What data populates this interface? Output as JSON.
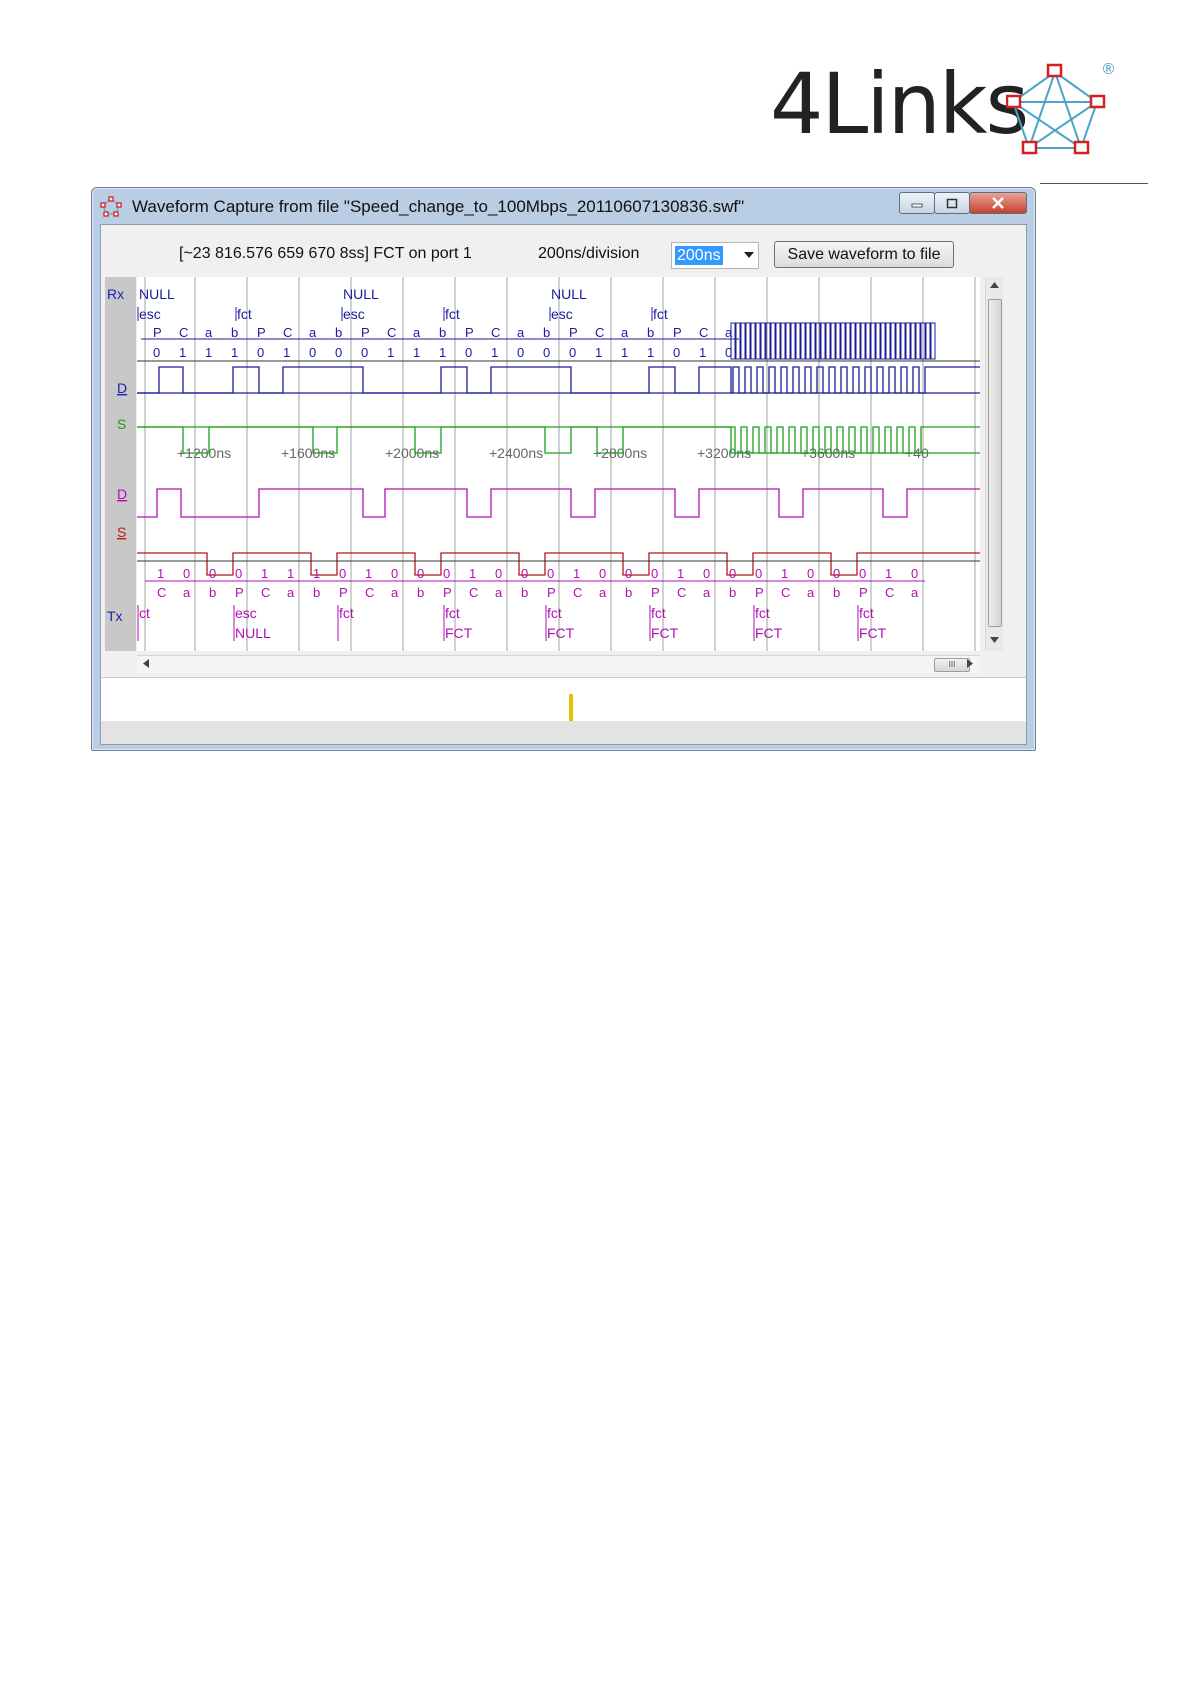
{
  "logo": {
    "text": "4Links",
    "registered": "®"
  },
  "window": {
    "title": "Waveform Capture from file \"Speed_change_to_100Mbps_20110607130836.swf\"",
    "buttons": {
      "minimize": "minimize",
      "maximize": "maximize",
      "close": "close"
    }
  },
  "toolbar": {
    "status": "[~23 816.576 659 670 8ss] FCT on port 1",
    "division": "200ns/division",
    "zoom": "200ns",
    "save_label": "Save waveform to file"
  },
  "labels": {
    "rx": "Rx",
    "tx": "Tx",
    "d": "D",
    "s": "S"
  },
  "colors": {
    "rx_d": "#1c1c9c",
    "rx_s": "#1aa01a",
    "tx_d": "#b010b0",
    "tx_s": "#b01818",
    "grid": "#8a8a8a",
    "selection": "#3399ff",
    "marker": "#e8c000"
  },
  "time_labels": [
    "+1200ns",
    "+1600ns",
    "+2000ns",
    "+2400ns",
    "+2800ns",
    "+3200ns",
    "+3600ns",
    "+40"
  ],
  "rx_tokens": [
    {
      "name": "NULL",
      "sub": "esc"
    },
    {
      "name": "",
      "sub": "fct"
    },
    {
      "name": "NULL",
      "sub": "esc"
    },
    {
      "name": "",
      "sub": "fct"
    },
    {
      "name": "NULL",
      "sub": "esc"
    },
    {
      "name": "",
      "sub": "fct"
    }
  ],
  "rx_fields": [
    "P",
    "C",
    "a",
    "b",
    "P",
    "C",
    "a",
    "b",
    "P",
    "C",
    "a",
    "b",
    "P",
    "C",
    "a",
    "b",
    "P",
    "C",
    "a",
    "b",
    "P",
    "C",
    "a"
  ],
  "rx_bits": [
    "0",
    "1",
    "1",
    "1",
    "0",
    "1",
    "0",
    "0",
    "0",
    "1",
    "1",
    "1",
    "0",
    "1",
    "0",
    "0",
    "0",
    "1",
    "1",
    "1",
    "0",
    "1",
    "0"
  ],
  "tx_bits": [
    "1",
    "0",
    "0",
    "0",
    "1",
    "1",
    "1",
    "0",
    "1",
    "0",
    "0",
    "0",
    "1",
    "0",
    "0",
    "0",
    "1",
    "0",
    "0",
    "0",
    "1",
    "0",
    "0",
    "0",
    "1",
    "0",
    "0",
    "0",
    "1",
    "0"
  ],
  "tx_fields": [
    "C",
    "a",
    "b",
    "P",
    "C",
    "a",
    "b",
    "P",
    "C",
    "a",
    "b",
    "P",
    "C",
    "a",
    "b",
    "P",
    "C",
    "a",
    "b",
    "P",
    "C",
    "a",
    "b",
    "P",
    "C",
    "a",
    "b",
    "P",
    "C",
    "a"
  ],
  "tx_tokens": [
    {
      "name": "",
      "sub": "ct"
    },
    {
      "name": "NULL",
      "sub": "esc"
    },
    {
      "name": "",
      "sub": "fct"
    },
    {
      "name": "FCT",
      "sub": "fct"
    },
    {
      "name": "FCT",
      "sub": "fct"
    },
    {
      "name": "FCT",
      "sub": "fct"
    },
    {
      "name": "FCT",
      "sub": "fct"
    },
    {
      "name": "FCT",
      "sub": "fct"
    }
  ],
  "scrollbar_grip": "III"
}
